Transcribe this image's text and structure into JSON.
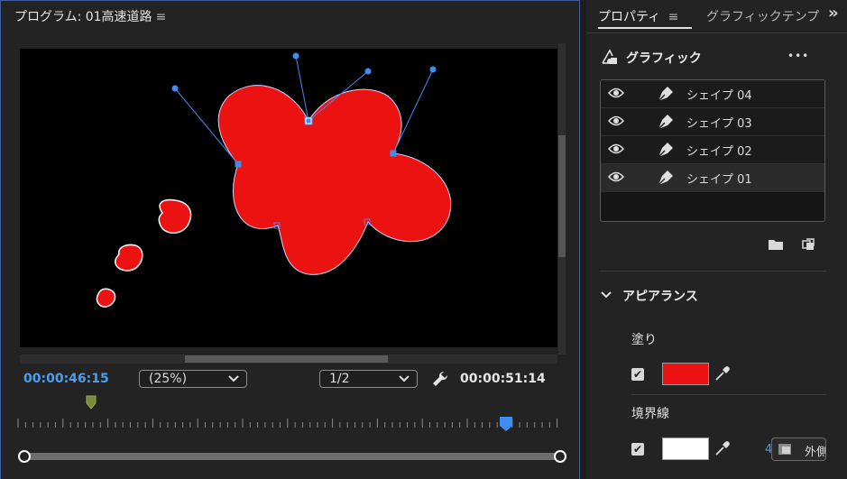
{
  "program": {
    "title": "プログラム: 01高速道路",
    "menu_icon": "≡",
    "current_timecode": "00:00:46:15",
    "zoom": "(25%)",
    "resolution": "1/2",
    "duration_timecode": "00:00:51:14"
  },
  "properties": {
    "tab_active": "プロパティ",
    "tab_menu_icon": "≡",
    "tab_other": "グラフィックテンプ",
    "overflow_icon": "»",
    "graphic_title": "グラフィック",
    "more_icon": "•••",
    "layers": [
      {
        "label": "シェイプ 04"
      },
      {
        "label": "シェイプ 03"
      },
      {
        "label": "シェイプ 02"
      },
      {
        "label": "シェイプ 01"
      }
    ],
    "appearance_title": "アピアランス",
    "fill_label": "塗り",
    "fill_color": "#ec1212",
    "stroke_label": "境界線",
    "stroke_color": "#ffffff",
    "stroke_width": "4.0",
    "stroke_type": "外側"
  },
  "colors": {
    "accent": "#4b9eef",
    "shape_fill": "#ec1212",
    "handle": "#3d8ef0"
  }
}
